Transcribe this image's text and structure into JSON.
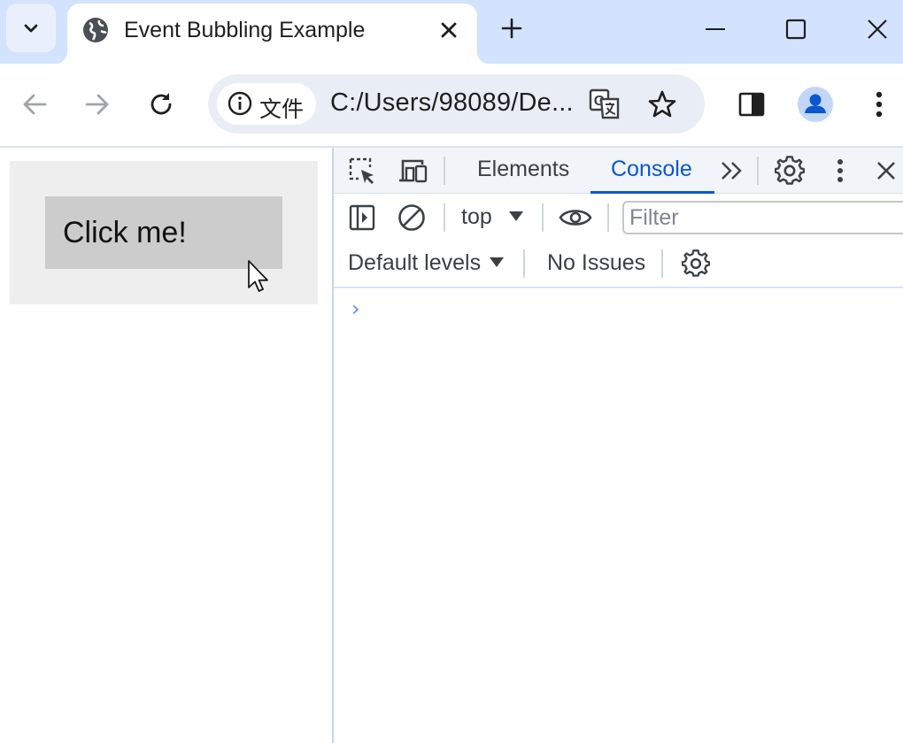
{
  "browser": {
    "tab_title": "Event Bubbling Example",
    "url": "C:/Users/98089/De...",
    "site_chip_label": "文件"
  },
  "page": {
    "button_label": "Click me!"
  },
  "devtools": {
    "tabs": [
      "Elements",
      "Console"
    ],
    "active_tab": "Console",
    "context": "top",
    "filter_placeholder": "Filter",
    "levels": "Default levels",
    "issues": "No Issues",
    "prompt": "›"
  },
  "colors": {
    "accent": "#0b57d0",
    "titlebar": "#d3e3fd",
    "omnibox": "#e9eef6"
  },
  "icons": [
    "tab-search-icon",
    "globe-icon",
    "close-icon",
    "plus-icon",
    "minimize-icon",
    "maximize-icon",
    "back-arrow-icon",
    "forward-arrow-icon",
    "reload-icon",
    "info-icon",
    "translate-icon",
    "star-icon",
    "side-panel-icon",
    "profile-icon",
    "kebab-menu-icon",
    "inspect-element-icon",
    "device-toolbar-icon",
    "more-tabs-icon",
    "gear-icon",
    "sidebar-toggle-icon",
    "clear-console-icon",
    "eye-icon",
    "dropdown-arrow-icon",
    "mouse-cursor-icon"
  ]
}
